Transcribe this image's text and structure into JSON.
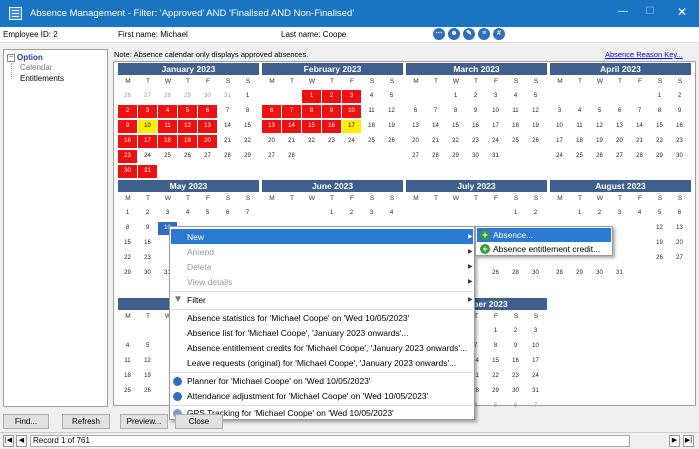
{
  "window": {
    "title": "Absence Management - Filter: 'Approved' AND 'Finalised AND Non-Finalised'",
    "min": "—",
    "max": "☐",
    "close": "✕"
  },
  "employee": {
    "id_text": "Employee ID: 2",
    "first_text": "First name: Michael",
    "last_text": "Last name: Coope"
  },
  "tree": {
    "root": "Option",
    "children": [
      "Calendar",
      "Entitlements"
    ]
  },
  "note": "Note: Absence calendar only displays approved absences.",
  "reason_link": "Absence Reason Key...",
  "day_headers": [
    "M",
    "T",
    "W",
    "T",
    "F",
    "S",
    "S"
  ],
  "months": [
    {
      "name": "January 2023",
      "weeks": [
        [
          "26",
          "27",
          "28",
          "29",
          "30",
          "31",
          "1"
        ],
        [
          "2",
          "3",
          "4",
          "5",
          "6",
          "7",
          "8"
        ],
        [
          "9",
          "10",
          "11",
          "12",
          "13",
          "14",
          "15"
        ],
        [
          "16",
          "17",
          "18",
          "19",
          "20",
          "21",
          "22"
        ],
        [
          "23",
          "24",
          "25",
          "26",
          "27",
          "28",
          "29"
        ],
        [
          "30",
          "31",
          "",
          "",
          "",
          "",
          ""
        ]
      ]
    },
    {
      "name": "February 2023",
      "weeks": [
        [
          "",
          "",
          "1",
          "2",
          "3",
          "4",
          "5"
        ],
        [
          "6",
          "7",
          "8",
          "9",
          "10",
          "11",
          "12"
        ],
        [
          "13",
          "14",
          "15",
          "16",
          "17",
          "18",
          "19"
        ],
        [
          "20",
          "21",
          "22",
          "23",
          "24",
          "25",
          "26"
        ],
        [
          "27",
          "28",
          "",
          "",
          "",
          "",
          ""
        ]
      ]
    },
    {
      "name": "March 2023",
      "weeks": [
        [
          "",
          "",
          "1",
          "2",
          "3",
          "4",
          "5"
        ],
        [
          "6",
          "7",
          "8",
          "9",
          "10",
          "11",
          "12"
        ],
        [
          "13",
          "14",
          "15",
          "16",
          "17",
          "18",
          "19"
        ],
        [
          "20",
          "21",
          "22",
          "23",
          "24",
          "25",
          "26"
        ],
        [
          "27",
          "28",
          "29",
          "30",
          "31",
          "",
          ""
        ]
      ]
    },
    {
      "name": "April 2023",
      "weeks": [
        [
          "",
          "",
          "",
          "",
          "",
          "1",
          "2"
        ],
        [
          "3",
          "4",
          "5",
          "6",
          "7",
          "8",
          "9"
        ],
        [
          "10",
          "11",
          "12",
          "13",
          "14",
          "15",
          "16"
        ],
        [
          "17",
          "18",
          "19",
          "20",
          "21",
          "22",
          "23"
        ],
        [
          "24",
          "25",
          "26",
          "27",
          "28",
          "29",
          "30"
        ]
      ]
    },
    {
      "name": "May 2023",
      "weeks": [
        [
          "1",
          "2",
          "3",
          "4",
          "5",
          "6",
          "7"
        ],
        [
          "8",
          "9",
          "10",
          "",
          "",
          "",
          ""
        ],
        [
          "15",
          "16",
          "",
          "",
          "",
          "",
          ""
        ],
        [
          "22",
          "23",
          "",
          "",
          "",
          "",
          ""
        ],
        [
          "29",
          "30",
          "31",
          "",
          "",
          "",
          ""
        ]
      ]
    },
    {
      "name": "June 2023",
      "weeks": [
        [
          "",
          "",
          "",
          "1",
          "2",
          "3",
          "4"
        ]
      ]
    },
    {
      "name": "July 2023",
      "weeks": [
        [
          "",
          "",
          "",
          "",
          "",
          "1",
          "2"
        ],
        [],
        [],
        [],
        [
          "",
          "",
          "",
          "",
          "26",
          "28",
          "30"
        ]
      ]
    },
    {
      "name": "August 2023",
      "weeks": [
        [
          "",
          "1",
          "2",
          "3",
          "4",
          "5",
          "6"
        ],
        [
          "",
          "",
          "",
          "",
          "",
          "12",
          "13"
        ],
        [
          "",
          "",
          "",
          "",
          "",
          "19",
          "20"
        ],
        [
          "",
          "",
          "",
          "",
          "",
          "26",
          "27"
        ],
        [
          "28",
          "29",
          "30",
          "31",
          "",
          "",
          ""
        ]
      ]
    },
    {
      "name": "Sep",
      "weeks": [
        [
          "",
          "",
          "",
          "",
          "",
          "",
          ""
        ],
        [
          "4",
          "5",
          "",
          "",
          "",
          "",
          ""
        ],
        [
          "11",
          "12",
          "",
          "",
          "",
          "",
          ""
        ],
        [
          "18",
          "19",
          "",
          "",
          "",
          "",
          ""
        ],
        [
          "25",
          "26",
          "",
          "",
          "",
          "",
          ""
        ]
      ]
    },
    {
      "name": "r 2023",
      "weeks": [
        [
          "",
          "",
          "",
          "",
          "",
          "",
          ""
        ],
        [
          "",
          "",
          "",
          "",
          "3",
          "4",
          "5"
        ],
        [
          "",
          "",
          "",
          "",
          "10",
          "11",
          "12"
        ],
        [
          "",
          "",
          "",
          "",
          "17",
          "18",
          "19"
        ],
        [
          "",
          "",
          "",
          "",
          "24",
          "25",
          "26"
        ]
      ]
    },
    {
      "name": "December 2023",
      "weeks": [
        [
          "",
          "",
          "",
          "",
          "1",
          "2",
          "3"
        ],
        [
          "4",
          "5",
          "6",
          "7",
          "8",
          "9",
          "10"
        ],
        [
          "11",
          "12",
          "13",
          "14",
          "15",
          "16",
          "17"
        ],
        [
          "18",
          "19",
          "20",
          "21",
          "22",
          "23",
          "24"
        ],
        [
          "25",
          "26",
          "27",
          "28",
          "29",
          "30",
          "31"
        ],
        [
          "1",
          "2",
          "3",
          "4",
          "5",
          "6",
          "7"
        ]
      ]
    }
  ],
  "highlights": {
    "red": [
      "January 2023:2",
      "January 2023:3",
      "January 2023:4",
      "January 2023:5",
      "January 2023:6",
      "January 2023:9",
      "January 2023:11",
      "January 2023:12",
      "January 2023:13",
      "January 2023:16",
      "January 2023:17",
      "January 2023:18",
      "January 2023:19",
      "January 2023:20",
      "January 2023:23",
      "January 2023:30",
      "January 2023:31",
      "February 2023:1",
      "February 2023:2",
      "February 2023:3",
      "February 2023:6",
      "February 2023:7",
      "February 2023:8",
      "February 2023:9",
      "February 2023:10",
      "February 2023:13",
      "February 2023:14",
      "February 2023:15",
      "February 2023:16"
    ],
    "yellow": [
      "January 2023:10",
      "February 2023:17"
    ],
    "selected": [
      "May 2023:10"
    ]
  },
  "context_menu": {
    "new": "New",
    "amend": "Amend",
    "delete": "Delete",
    "view": "View details",
    "filter": "Filter",
    "stats": "Absence statistics for 'Michael Coope' on 'Wed 10/05/2023'",
    "list": "Absence list for 'Michael Coope', 'January 2023 onwards'...",
    "credits": "Absence entitlement credits for 'Michael Coope', 'January 2023 onwards'...",
    "leave": "Leave requests (original) for 'Michael Coope', 'January 2023 onwards'...",
    "planner": "Planner for 'Michael Coope' on 'Wed 10/05/2023'",
    "attendance": "Attendance adjustment for 'Michael Coope' on 'Wed 10/05/2023'",
    "gps": "GPS Tracking for 'Michael Coope' on 'Wed 10/05/2023'"
  },
  "submenu": {
    "absence": "Absence...",
    "credit": "Absence entitlement credit..."
  },
  "buttons": {
    "find": "Find...",
    "refresh": "Refresh",
    "preview": "Preview...",
    "close": "Close"
  },
  "status": {
    "record": "Record 1 of 761"
  },
  "colors": {
    "titlebar": "#1a74c4",
    "month_header": "#3f5f8c",
    "absence_red": "#ee1111",
    "absence_yellow": "#ffee00",
    "menu_highlight": "#2a7ad4"
  }
}
